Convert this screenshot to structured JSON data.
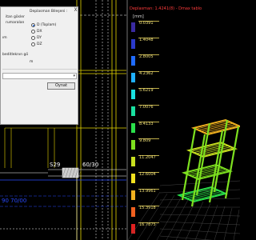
{
  "cad": {
    "beam_label": "S29",
    "section_label": "60/30",
    "bottom_label": "90 70/00",
    "colors": {
      "grid_yellow": "#e8d800",
      "axis_blue": "#2a4bff",
      "white": "#ffffff"
    }
  },
  "view3d": {
    "header": "Deplasman: 1.4241(8) - Dmax tablo",
    "units": "[mm]",
    "legend": [
      {
        "value": "0.0391",
        "color": "#3a2aa0"
      },
      {
        "value": "1.4048",
        "color": "#2a3acc"
      },
      {
        "value": "2.8005",
        "color": "#1f6bff"
      },
      {
        "value": "4.2362",
        "color": "#1fb0ff"
      },
      {
        "value": "5.6219",
        "color": "#19e0e0"
      },
      {
        "value": "7.0076",
        "color": "#19e0a0"
      },
      {
        "value": "8.4133",
        "color": "#2ae04a"
      },
      {
        "value": "9.809",
        "color": "#7de01f"
      },
      {
        "value": "11.2047",
        "color": "#c8e01f"
      },
      {
        "value": "12.6004",
        "color": "#f0e01f"
      },
      {
        "value": "13.9961",
        "color": "#f0b01f"
      },
      {
        "value": "15.3918",
        "color": "#f0601f"
      },
      {
        "value": "16.7875",
        "color": "#e0201f"
      }
    ]
  },
  "dialog": {
    "lines_left": [
      "itan gösler",
      "rumaralan",
      "",
      "ım",
      "",
      "beditleknın gö"
    ],
    "group_title": "Deplasman Bileşeni :",
    "options": [
      {
        "label": "D (Toplam)",
        "selected": true
      },
      {
        "label": "DX",
        "selected": false
      },
      {
        "label": "DY",
        "selected": false
      },
      {
        "label": "DZ",
        "selected": false
      }
    ],
    "small_text": "m",
    "ok_label": "Oynat",
    "close_label": "X"
  }
}
